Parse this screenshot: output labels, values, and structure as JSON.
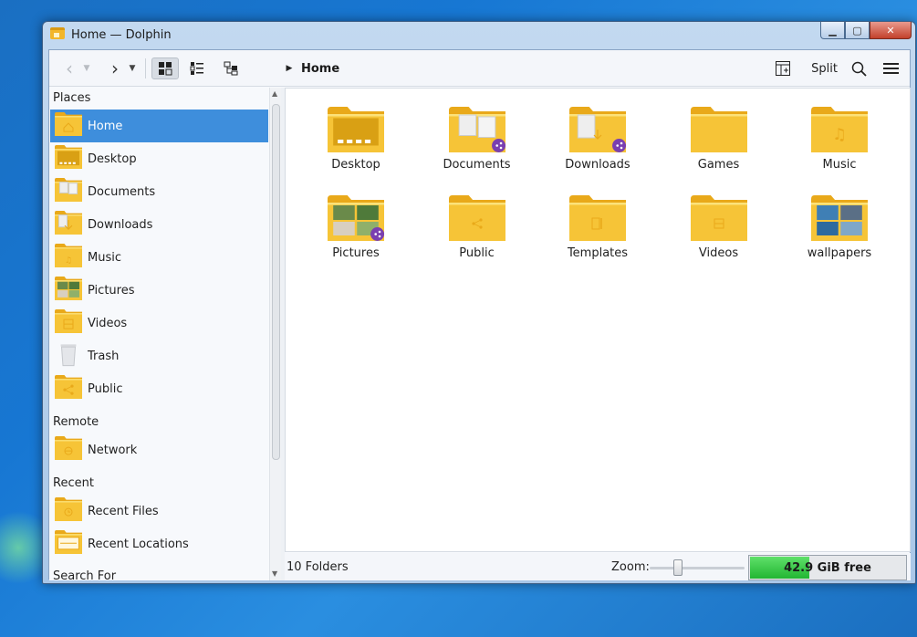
{
  "window": {
    "title": "Home — Dolphin"
  },
  "toolbar": {
    "breadcrumb": "Home",
    "split_label": "Split"
  },
  "sidebar": {
    "sections": {
      "places": "Places",
      "remote": "Remote",
      "recent": "Recent",
      "search": "Search For"
    },
    "places": [
      {
        "label": "Home",
        "icon": "home-folder-icon",
        "selected": true
      },
      {
        "label": "Desktop",
        "icon": "desktop-folder-icon"
      },
      {
        "label": "Documents",
        "icon": "documents-folder-icon"
      },
      {
        "label": "Downloads",
        "icon": "downloads-folder-icon"
      },
      {
        "label": "Music",
        "icon": "music-folder-icon"
      },
      {
        "label": "Pictures",
        "icon": "pictures-folder-icon"
      },
      {
        "label": "Videos",
        "icon": "videos-folder-icon"
      },
      {
        "label": "Trash",
        "icon": "trash-icon"
      },
      {
        "label": "Public",
        "icon": "public-folder-icon"
      }
    ],
    "remote": [
      {
        "label": "Network",
        "icon": "network-folder-icon"
      }
    ],
    "recent": [
      {
        "label": "Recent Files",
        "icon": "recent-files-icon"
      },
      {
        "label": "Recent Locations",
        "icon": "recent-locations-icon"
      }
    ]
  },
  "content": {
    "items": [
      {
        "label": "Desktop",
        "icon": "desktop-folder-icon"
      },
      {
        "label": "Documents",
        "icon": "documents-folder-icon"
      },
      {
        "label": "Downloads",
        "icon": "downloads-folder-icon"
      },
      {
        "label": "Games",
        "icon": "folder-icon"
      },
      {
        "label": "Music",
        "icon": "music-folder-icon"
      },
      {
        "label": "Pictures",
        "icon": "pictures-folder-icon"
      },
      {
        "label": "Public",
        "icon": "public-folder-icon"
      },
      {
        "label": "Templates",
        "icon": "templates-folder-icon"
      },
      {
        "label": "Videos",
        "icon": "videos-folder-icon"
      },
      {
        "label": "wallpapers",
        "icon": "wallpapers-folder-icon"
      }
    ]
  },
  "statusbar": {
    "summary": "10 Folders",
    "zoom_label": "Zoom:",
    "zoom_level_fraction": 0.28,
    "free_space": "42.9 GiB free",
    "disk_free_fraction": 0.38
  },
  "colors": {
    "folder": "#f6c437",
    "folder_dark": "#e9a91a",
    "selection": "#3e8edc",
    "share_badge": "#7a3fb0",
    "free_fill": "#2dbb3a"
  }
}
